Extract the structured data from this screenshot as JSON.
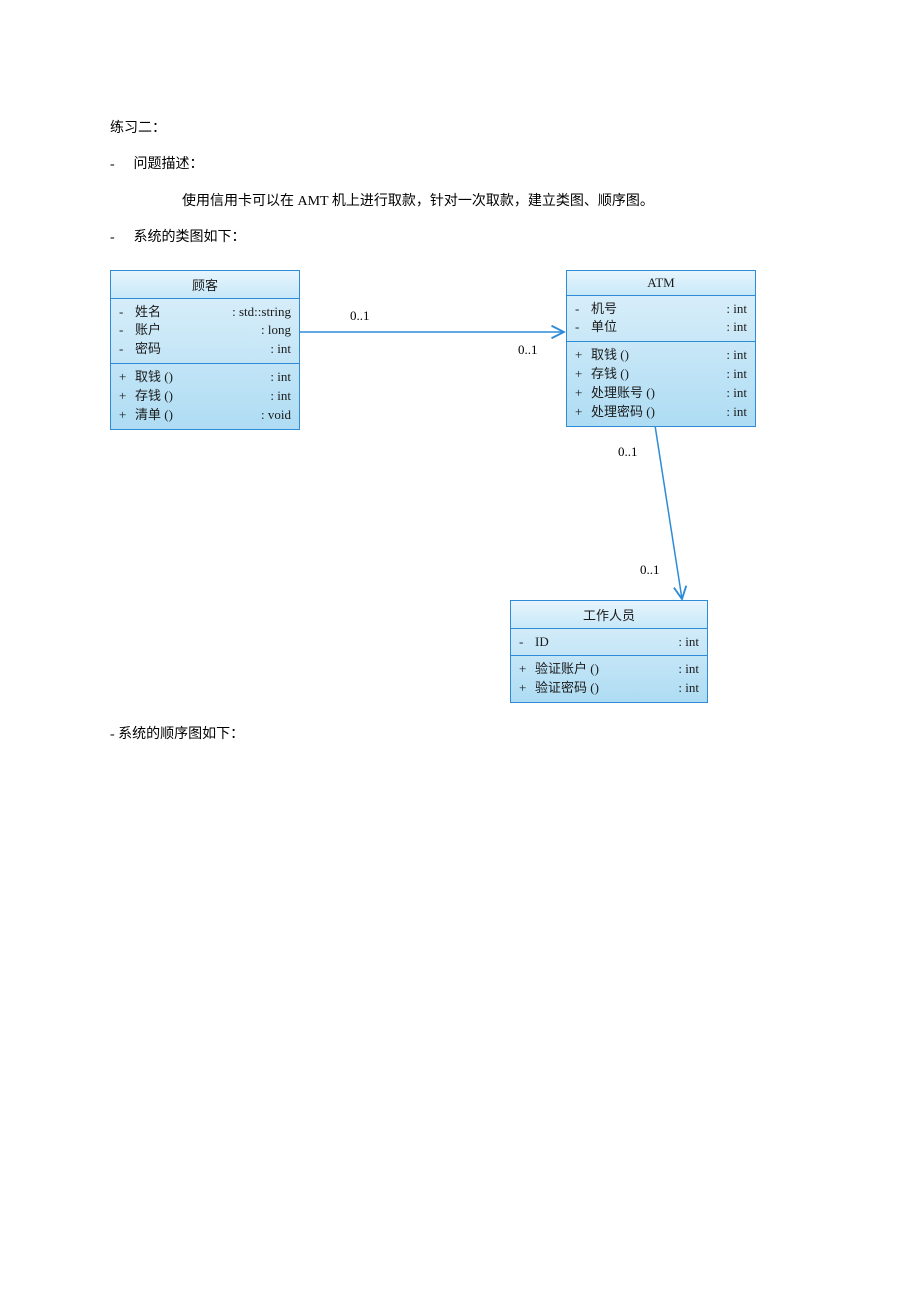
{
  "text": {
    "heading": "练习二：",
    "bullet1_label": "问题描述：",
    "bullet1_body": "使用信用卡可以在 AMT 机上进行取款，针对一次取款，建立类图、顺序图。",
    "bullet2_label": "系统的类图如下：",
    "bullet3_label": "- 系统的顺序图如下：",
    "dash": "-"
  },
  "mult": {
    "m1": "0..1",
    "m2": "0..1",
    "m3": "0..1",
    "m4": "0..1"
  },
  "classes": {
    "customer": {
      "name": "顾客",
      "attrs": [
        {
          "vis": "-",
          "name": "姓名",
          "type": ": std::string"
        },
        {
          "vis": "-",
          "name": "账户",
          "type": ": long"
        },
        {
          "vis": "-",
          "name": "密码",
          "type": ": int"
        }
      ],
      "ops": [
        {
          "vis": "+",
          "name": "取钱 ()",
          "type": ": int"
        },
        {
          "vis": "+",
          "name": "存钱 ()",
          "type": ": int"
        },
        {
          "vis": "+",
          "name": "清单 ()",
          "type": ": void"
        }
      ]
    },
    "atm": {
      "name": "ATM",
      "attrs": [
        {
          "vis": "-",
          "name": "机号",
          "type": ": int"
        },
        {
          "vis": "-",
          "name": "单位",
          "type": ": int"
        }
      ],
      "ops": [
        {
          "vis": "+",
          "name": "取钱 ()",
          "type": ": int"
        },
        {
          "vis": "+",
          "name": "存钱 ()",
          "type": ": int"
        },
        {
          "vis": "+",
          "name": "处理账号 ()",
          "type": ": int"
        },
        {
          "vis": "+",
          "name": "处理密码 ()",
          "type": ": int"
        }
      ]
    },
    "staff": {
      "name": "工作人员",
      "attrs": [
        {
          "vis": "-",
          "name": "ID",
          "type": ": int"
        }
      ],
      "ops": [
        {
          "vis": "+",
          "name": "验证账户 ()",
          "type": ": int"
        },
        {
          "vis": "+",
          "name": "验证密码 ()",
          "type": ": int"
        }
      ]
    }
  }
}
